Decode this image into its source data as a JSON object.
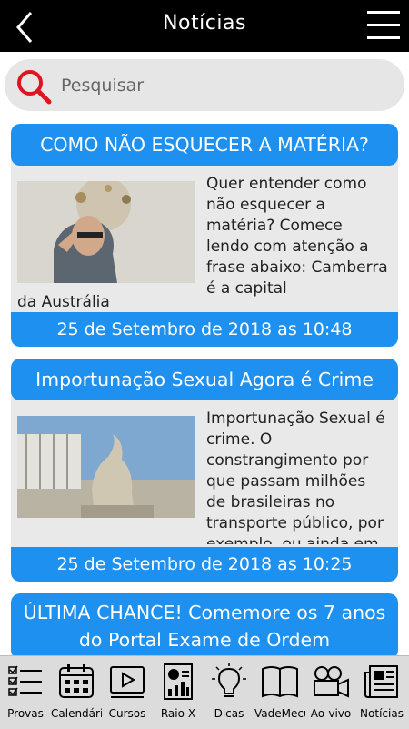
{
  "header": {
    "title": "Notícias"
  },
  "search": {
    "placeholder": "Pesquisar"
  },
  "news": [
    {
      "title": "COMO NÃO ESQUECER A MATÉRIA?",
      "excerpt": "Quer entender como não esquecer a matéria? Comece lendo com atenção a frase abaixo: Camberra é a capital",
      "overflow": "da Austrália",
      "date": "25 de Setembro de 2018 as 10:48"
    },
    {
      "title": "Importunação Sexual Agora é Crime",
      "excerpt": "Importunação Sexual é crime. O constrangimento por que passam milhões de brasileiras no transporte público, por exemplo, ou ainda em",
      "date": "25 de Setembro de 2018 as 10:25"
    },
    {
      "title": "ÚLTIMA CHANCE! Comemore os 7 anos do Portal Exame de Ordem"
    }
  ],
  "nav": {
    "items": [
      {
        "label": "Provas"
      },
      {
        "label": "Calendário"
      },
      {
        "label": "Cursos"
      },
      {
        "label": "Raio-X"
      },
      {
        "label": "Dicas"
      },
      {
        "label": "VadeMecum"
      },
      {
        "label": "Ao-vivo"
      },
      {
        "label": "Notícias"
      }
    ]
  }
}
